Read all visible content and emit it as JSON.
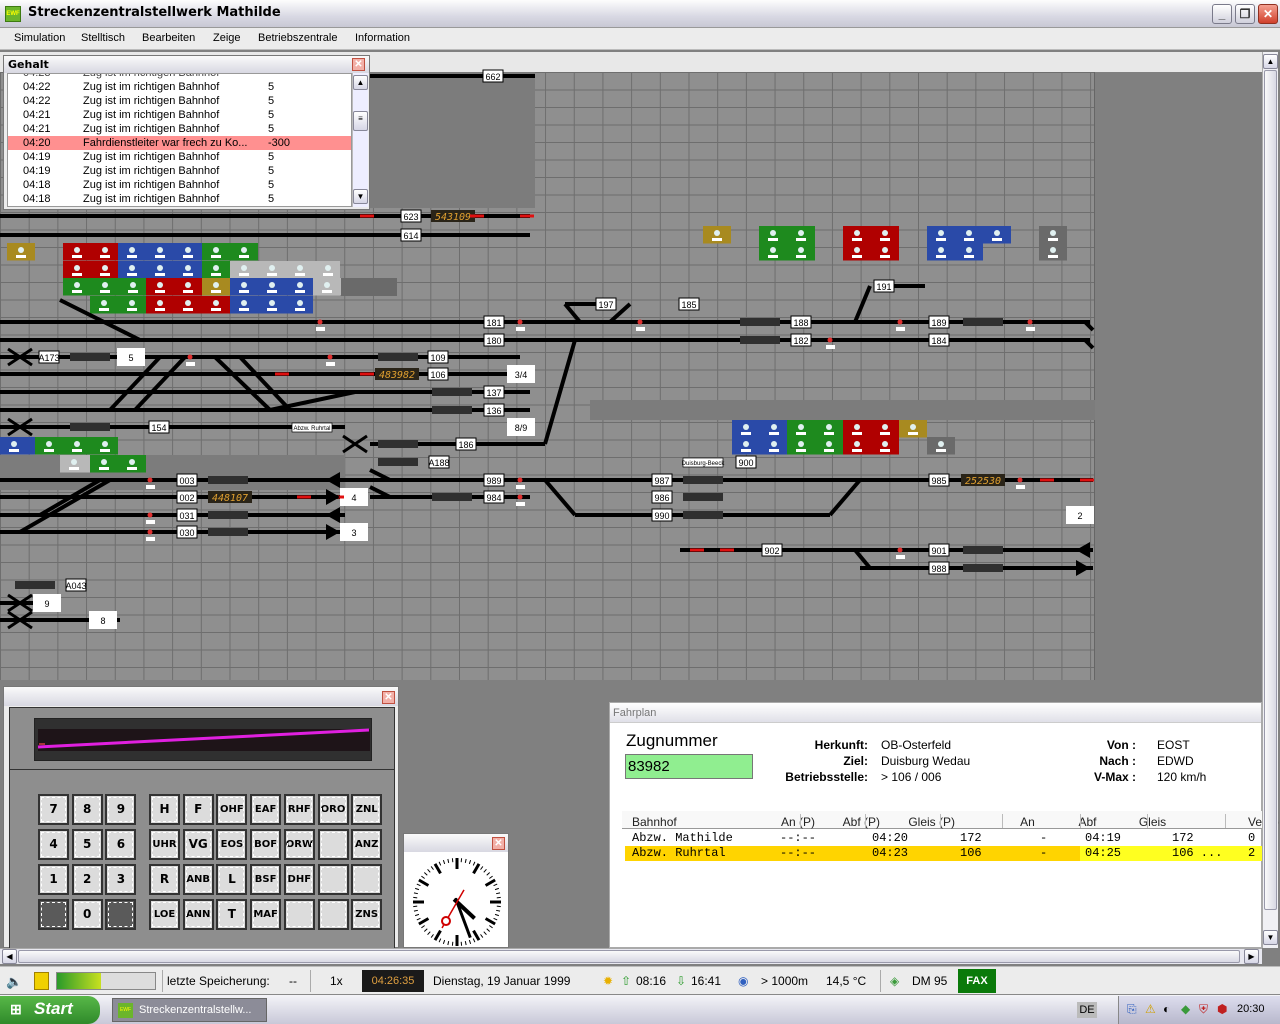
{
  "window": {
    "title": "Streckenzentralstellwerk Mathilde",
    "logo": "EWF"
  },
  "menu": [
    "Simulation",
    "Stelltisch",
    "Bearbeiten",
    "Zeige",
    "Betriebszentrale",
    "Information"
  ],
  "gehalt": {
    "title": "Gehalt",
    "rows": [
      {
        "time": "04:22",
        "text": "Zug ist im richtigen Bahnhof",
        "value": "5"
      },
      {
        "time": "04:22",
        "text": "Zug ist im richtigen Bahnhof",
        "value": "5"
      },
      {
        "time": "04:21",
        "text": "Zug ist im richtigen Bahnhof",
        "value": "5"
      },
      {
        "time": "04:21",
        "text": "Zug ist im richtigen Bahnhof",
        "value": "5"
      },
      {
        "time": "04:20",
        "text": "Fahrdienstleiter war frech zu Ko...",
        "value": "-300",
        "highlight": true
      },
      {
        "time": "04:19",
        "text": "Zug ist im richtigen Bahnhof",
        "value": "5"
      },
      {
        "time": "04:19",
        "text": "Zug ist im richtigen Bahnhof",
        "value": "5"
      },
      {
        "time": "04:18",
        "text": "Zug ist im richtigen Bahnhof",
        "value": "5"
      },
      {
        "time": "04:18",
        "text": "Zug ist im richtigen Bahnhof",
        "value": "5"
      }
    ]
  },
  "diagram": {
    "track_labels": [
      "662",
      "623",
      "614",
      "181",
      "180",
      "109",
      "106",
      "137",
      "136",
      "154",
      "186",
      "A188",
      "A173",
      "003",
      "002",
      "031",
      "030",
      "989",
      "984",
      "987",
      "986",
      "990",
      "900",
      "902",
      "901",
      "988",
      "985",
      "188",
      "182",
      "189",
      "184",
      "197",
      "185",
      "191",
      "A043"
    ],
    "platform_labels": [
      "5",
      "3/4",
      "8/9",
      "4",
      "3",
      "2",
      "9",
      "8"
    ],
    "train_counters": [
      "543109",
      "483982",
      "448107",
      "252530"
    ],
    "place_labels": [
      "Abzw. Ruhrtal",
      "Duisburg-Beeck"
    ]
  },
  "keypad": {
    "keys": [
      [
        "7",
        "8",
        "9"
      ],
      [
        "4",
        "5",
        "6"
      ],
      [
        "1",
        "2",
        "3"
      ],
      [
        "",
        "0",
        ""
      ]
    ],
    "commands": [
      [
        "H",
        "F",
        "OHF",
        "EAF",
        "RHF",
        "ORO",
        "ZNL"
      ],
      [
        "UHR",
        "VG",
        "EOS",
        "BOF",
        "ORW",
        "",
        "ANZ"
      ],
      [
        "R",
        "ANB",
        "L",
        "BSF",
        "DHF",
        "",
        ""
      ],
      [
        "LOE",
        "ANN",
        "T",
        "MAF",
        "",
        "",
        "ZNS"
      ]
    ]
  },
  "fahrplan": {
    "title": "Fahrplan",
    "zugnummer_label": "Zugnummer",
    "zugnummer": "83982",
    "herkunft_label": "Herkunft:",
    "herkunft": "OB-Osterfeld",
    "ziel_label": "Ziel:",
    "ziel": "Duisburg Wedau",
    "betriebsstelle_label": "Betriebsstelle:",
    "betriebsstelle": "> 106 / 006",
    "von_label": "Von :",
    "von": "EOST",
    "nach_label": "Nach :",
    "nach": "EDWD",
    "vmax_label": "V-Max :",
    "vmax": "120 km/h",
    "columns": [
      "Bahnhof",
      "An (P)",
      "Abf (P)",
      "Gleis (P)",
      "An",
      "Abf",
      "Gleis",
      "Versp"
    ],
    "rows": [
      [
        "Abzw. Mathilde",
        "--:--",
        "04:20",
        "172",
        "-",
        "04:19",
        "172",
        "0"
      ],
      [
        "Abzw. Ruhrtal",
        "--:--",
        "04:23",
        "106",
        "-",
        "04:25",
        "106 ...",
        "2"
      ]
    ]
  },
  "status": {
    "save_label": "letzte Speicherung:",
    "save_value": "--",
    "speed": "1x",
    "clock": "04:26:35",
    "date": "Dienstag, 19 Januar 1999",
    "sunrise": "08:16",
    "sunset": "16:41",
    "visibility": "> 1000m",
    "temperature": "14,5 °C",
    "money": "DM 95",
    "fax": "FAX",
    "progress": 0.45
  },
  "taskbar": {
    "start": "Start",
    "task": "Streckenzentralstellw...",
    "lang": "DE",
    "time": "20:30"
  },
  "colors": {
    "red": "#b00000",
    "blue": "#2a4aa8",
    "green": "#1e8a1e",
    "gold": "#a88a20",
    "highlight": "#ff9090",
    "yellow_row": "#ffd400"
  }
}
